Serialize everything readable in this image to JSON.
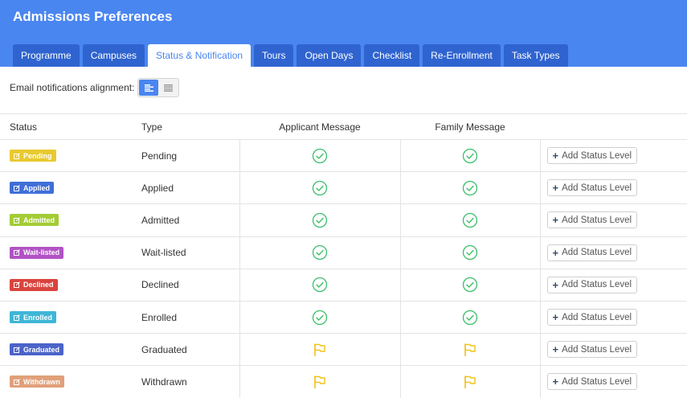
{
  "header": {
    "title": "Admissions Preferences"
  },
  "tabs": [
    {
      "label": "Programme"
    },
    {
      "label": "Campuses"
    },
    {
      "label": "Status & Notification"
    },
    {
      "label": "Tours"
    },
    {
      "label": "Open Days"
    },
    {
      "label": "Checklist"
    },
    {
      "label": "Re-Enrollment"
    },
    {
      "label": "Task Types"
    }
  ],
  "active_tab": "Status & Notification",
  "alignment": {
    "label": "Email notifications alignment:",
    "selected": "left"
  },
  "table": {
    "headers": {
      "status": "Status",
      "type": "Type",
      "applicant": "Applicant Message",
      "family": "Family Message"
    },
    "add_label": "Add Status Level",
    "rows": [
      {
        "badge": "Pending",
        "color": "#e8c92f",
        "type": "Pending",
        "applicant_icon": "check-circle-icon",
        "family_icon": "check-circle-icon"
      },
      {
        "badge": "Applied",
        "color": "#3f6fd8",
        "type": "Applied",
        "applicant_icon": "check-circle-icon",
        "family_icon": "check-circle-icon"
      },
      {
        "badge": "Admitted",
        "color": "#a3cc35",
        "type": "Admitted",
        "applicant_icon": "check-circle-icon",
        "family_icon": "check-circle-icon"
      },
      {
        "badge": "Wait-listed",
        "color": "#b153c5",
        "type": "Wait-listed",
        "applicant_icon": "check-circle-icon",
        "family_icon": "check-circle-icon"
      },
      {
        "badge": "Declined",
        "color": "#d9443e",
        "type": "Declined",
        "applicant_icon": "check-circle-icon",
        "family_icon": "check-circle-icon"
      },
      {
        "badge": "Enrolled",
        "color": "#3fb6d6",
        "type": "Enrolled",
        "applicant_icon": "check-circle-icon",
        "family_icon": "check-circle-icon"
      },
      {
        "badge": "Graduated",
        "color": "#4b63c9",
        "type": "Graduated",
        "applicant_icon": "flag-icon",
        "family_icon": "flag-icon"
      },
      {
        "badge": "Withdrawn",
        "color": "#e0a07a",
        "type": "Withdrawn",
        "applicant_icon": "flag-icon",
        "family_icon": "flag-icon"
      }
    ]
  },
  "colors": {
    "header_bg": "#4a86f0",
    "tab_bg": "#2f64d0",
    "check": "#3cc06a",
    "flag": "#f1c21b"
  }
}
